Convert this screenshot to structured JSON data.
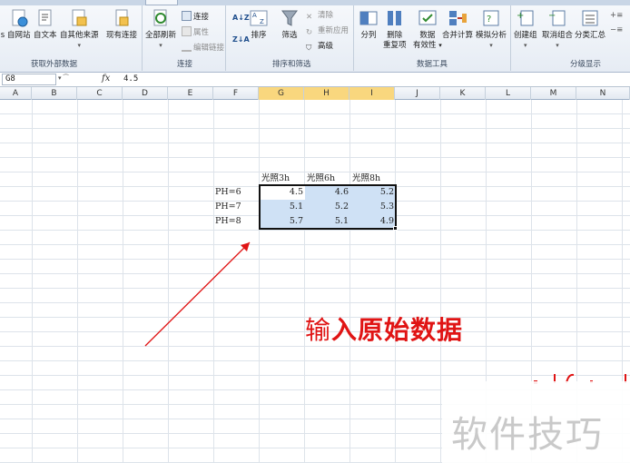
{
  "ribbon": {
    "groups": {
      "external_data": "获取外部数据",
      "connections": "连接",
      "sort_filter": "排序和筛选",
      "data_tools": "数据工具",
      "outline": "分级显示"
    },
    "buttons": {
      "from_access": "s",
      "from_web": "自网站",
      "from_text": "自文本",
      "from_other": "自其他来源",
      "existing_conn": "现有连接",
      "refresh_all": "全部刷新",
      "connections": "连接",
      "properties": "属性",
      "edit_links": "编辑链接",
      "sort_az": "A↓Z",
      "sort": "排序",
      "filter": "筛选",
      "clear": "清除",
      "reapply": "重新应用",
      "advanced": "高级",
      "text_to_columns": "分列",
      "remove_duplicates_1": "删除",
      "remove_duplicates_2": "重复项",
      "data_validation_1": "数据",
      "data_validation_2": "有效性",
      "consolidate": "合并计算",
      "what_if": "模拟分析",
      "group": "创建组",
      "ungroup": "取消组合",
      "subtotal": "分类汇总"
    },
    "colors": {
      "accent": "#2b579a",
      "selection": "#cfe1f5",
      "header_selected": "#f9d77e",
      "annotation": "#e01414"
    }
  },
  "formula_bar": {
    "name_box": "G8",
    "fx_icon": "fx-icon",
    "value": "4.5"
  },
  "columns": [
    "A",
    "B",
    "C",
    "D",
    "E",
    "F",
    "G",
    "H",
    "I",
    "J",
    "K",
    "L",
    "M",
    "N"
  ],
  "table": {
    "headers": [
      "光照3h",
      "光照6h",
      "光照8h"
    ],
    "rows": [
      {
        "label": "PH=6",
        "values": [
          "4.5",
          "4.6",
          "5.2"
        ]
      },
      {
        "label": "PH=7",
        "values": [
          "5.1",
          "5.2",
          "5.3"
        ]
      },
      {
        "label": "PH=8",
        "values": [
          "5.7",
          "5.1",
          "4.9"
        ]
      }
    ]
  },
  "annotation": {
    "text_part1": "输",
    "text_part2": "入原始数据",
    "arrow_icon": "red-arrow-icon"
  },
  "watermark": {
    "text": "软件技巧"
  }
}
